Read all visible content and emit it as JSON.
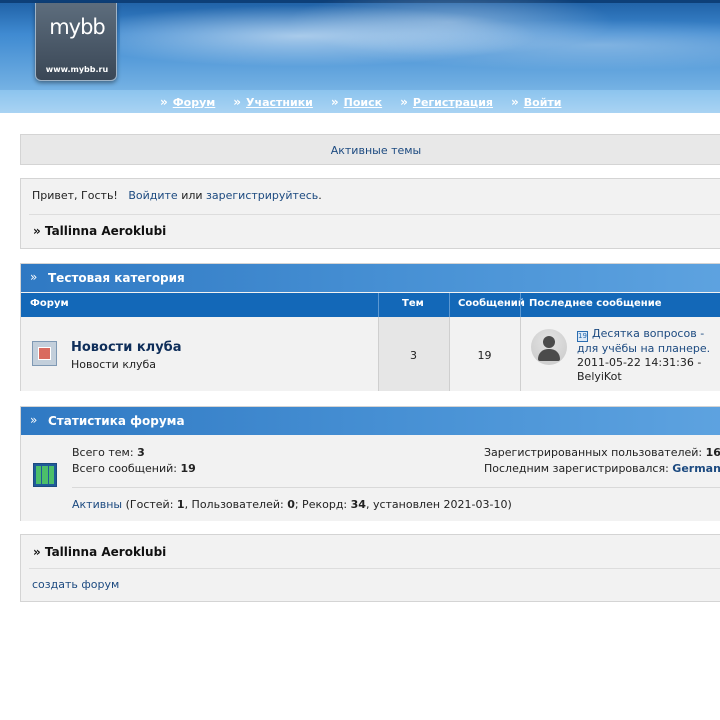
{
  "header": {
    "logo_text": "mybb",
    "logo_url": "www.mybb.ru",
    "nav": [
      {
        "label": "Форум"
      },
      {
        "label": "Участники"
      },
      {
        "label": "Поиск"
      },
      {
        "label": "Регистрация"
      },
      {
        "label": "Войти"
      }
    ],
    "nav_arrow": "»"
  },
  "active_topics": "Активные темы",
  "welcome": {
    "greeting": "Привет, Гость!",
    "login_link": "Войдите",
    "or": "или",
    "register_link": "зарегистрируйтесь",
    "period": ".",
    "crumb": "» Tallinna Aeroklubi"
  },
  "category": {
    "arrow": "»",
    "title": "Тестовая категория",
    "columns": {
      "forum": "Форум",
      "topics": "Тем",
      "posts": "Сообщений",
      "last_post": "Последнее сообщение"
    },
    "forum": {
      "title": "Новости клуба",
      "description": "Новости клуба",
      "topics": "3",
      "posts": "19",
      "last_post_title": "Десятка вопросов - для учёбы на планере.",
      "last_post_date": "2011-05-22 14:31:36 -",
      "last_post_author": "BelyiKot"
    }
  },
  "stats": {
    "arrow": "»",
    "title": "Статистика форума",
    "total_topics_label": "Всего тем:",
    "total_topics": "3",
    "total_posts_label": "Всего сообщений:",
    "total_posts": "19",
    "registered_label": "Зарегистрированных пользователей:",
    "registered": "16",
    "last_registered_label": "Последним зарегистрировался:",
    "last_registered": "German",
    "online_link": "Активны",
    "online_open": " (Гостей: ",
    "guests": "1",
    "users_label": ", Пользователей: ",
    "users": "0",
    "record_label": "; Рекорд: ",
    "record": "34",
    "record_set": ", установлен 2021-03-10)"
  },
  "footer": {
    "crumb": "» Tallinna Aeroklubi",
    "create_forum": "создать форум"
  },
  "colors": {
    "header_blue": "#3f8ad1",
    "category_bar": "#2f79c3",
    "column_bar": "#1368b8",
    "link": "#1c4a80"
  }
}
